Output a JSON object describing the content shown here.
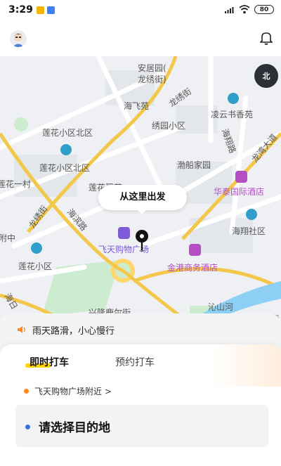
{
  "status_bar": {
    "time": "3:29",
    "battery": "80"
  },
  "map": {
    "labels": {
      "anjuyuan": "安居园(",
      "longxiujie_paren": "龙绣街)",
      "haifeiyuan": "海飞苑",
      "longxiujie_1": "龙绣街",
      "lingyun": "凌云书香苑",
      "lianhua_north_1": "莲花小区北区",
      "xiuyuan": "绣园小区",
      "haixiang_road": "海翔路",
      "longwan": "龙湾大道",
      "lianhua_north_2": "莲花小区北区",
      "bochuan": "渤船家园",
      "lianhua_1cun": "莲花一村",
      "lianhua_yuan": "莲花翠苑",
      "huatai": "华泰国际酒店",
      "longxiujie_2": "龙绣街",
      "haibin": "海滨路",
      "haixiang_she": "海翔社区",
      "fuzhong": "附中",
      "feitian": "飞天购物广场",
      "jingang": "金港商务酒店",
      "lianhua_xiaoqu": "莲花小区",
      "haiyang": "海日",
      "xinglong": "兴隆鹿尔街",
      "qinshan": "沁山河",
      "qing": "青"
    },
    "compass_label": "北",
    "start_bubble": "从这里出发"
  },
  "notice": {
    "text": "雨天路滑，小心慢行"
  },
  "tabs": {
    "now": "即时打车",
    "later": "预约打车"
  },
  "origin": {
    "text": "飞天购物广场附近 >"
  },
  "destination": {
    "placeholder": "请选择目的地"
  },
  "colors": {
    "accent_yellow": "#ffd400",
    "origin_dot": "#ff8a1f",
    "dest_dot": "#3b6fe0",
    "poi_blue": "#2f9fc9",
    "poi_purple": "#b34fc3"
  }
}
